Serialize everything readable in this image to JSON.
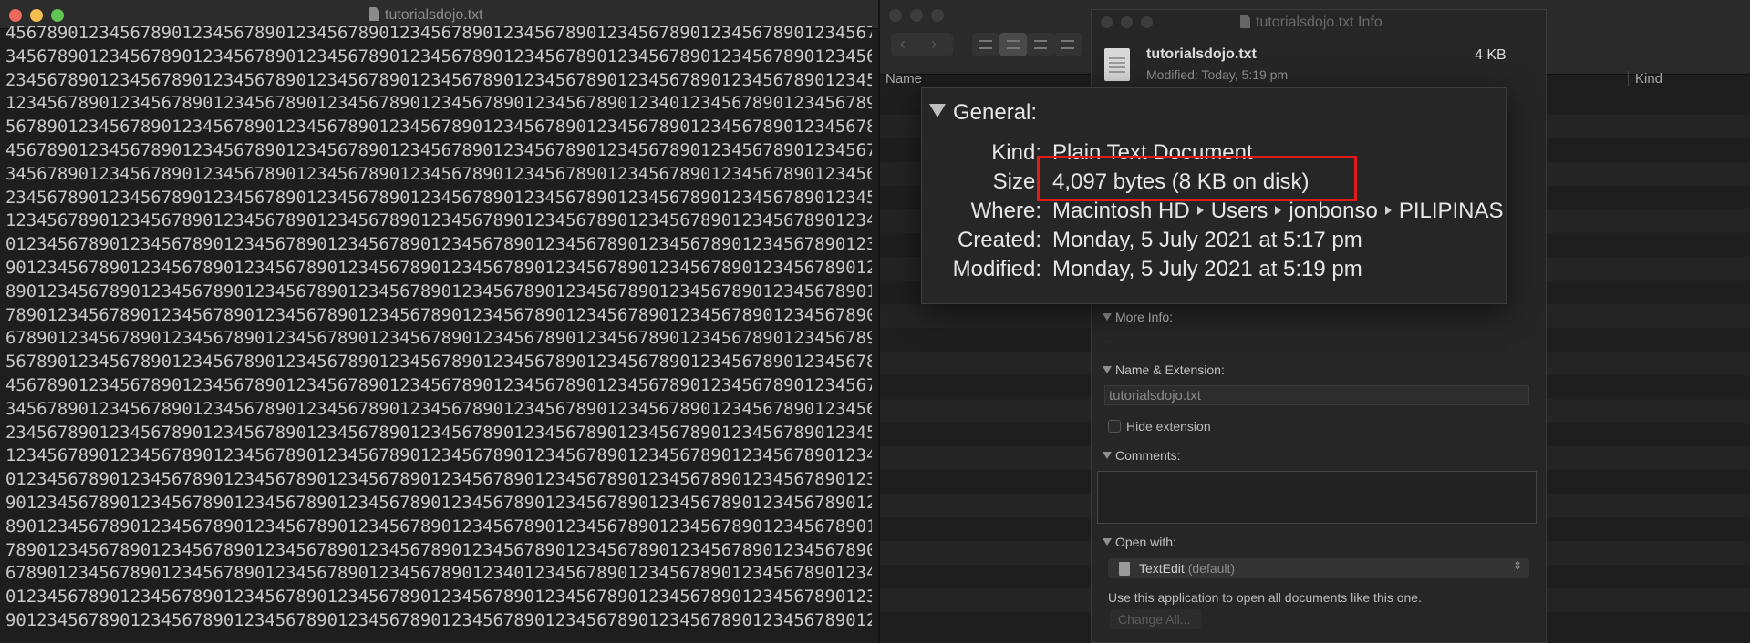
{
  "textedit": {
    "title": "tutorialsdojo.txt",
    "content": "45678901234567890123456789012345678901234567890123456789012345678901234567890123456789012\n34567890123456789012345678901234567890123456789012345678901234567890123456789012345678901\n23456789012345678901234567890123456789012345678901234567890123456789012345678901234567890\n12345678901234567890123456789012345678901234567890123456789012340123456789012345678901234\n56789012345678901234567890123456789012345678901234567890123456789012345678901234567890123\n45678901234567890123456789012345678901234567890123456789012345678901234567890123456789012\n34567890123456789012345678901234567890123456789012345678901234567890123456789012345678901\n23456789012345678901234567890123456789012345678901234567890123456789012345678901234567890\n12345678901234567890123456789012345678901234567890123456789012345678901234567890123456789\n01234567890123456789012345678901234567890123456789012345678901234567890123456789012345678\n90123456789012345678901234567890123456789012345678901234567890123456789012345678901234567\n89012345678901234567890123456789012345678901234567890123456789012345678901234567890123456\n78901234567890123456789012345678901234567890123456789012345678901234567890123456789012345\n67890123456789012345678901234567890123456789012345678901234567890123456789012345678901234\n56789012345678901234567890123456789012345678901234567890123456789012345678901234567890123\n45678901234567890123456789012345678901234567890123456789012345678901234567890123456789012\n34567890123456789012345678901234567890123456789012345678901234567890123456789012345678901\n23456789012345678901234567890123456789012345678901234567890123456789012345678901234567890\n12345678901234567890123456789012345678901234567890123456789012345678901234567890123456789\n01234567890123456789012345678901234567890123456789012345678901234567890123456789012345678\n90123456789012345678901234567890123456789012345678901234567890123456789012345678901234567\n89012345678901234567890123456789012345678901234567890123456789012345678901234567890123456\n78901234567890123456789012345678901234567890123456789012345678901234567890123456789012345\n67890123456789012345678901234567890123456789012340123456789012345678901234567890123456789\n01234567890123456789012345678901234567890123456789012345678901234567890123456789012345678\n90123456789012345678901234567890123456789012345678901234567890123456789012345678901234567"
  },
  "finder": {
    "columns": {
      "name": "Name",
      "date_fragment": "e",
      "kind": "Kind"
    }
  },
  "info_window": {
    "title": "tutorialsdojo.txt Info",
    "filename": "tutorialsdojo.txt",
    "filesize": "4 KB",
    "modified": "Modified: Today, 5:19 pm",
    "sections": {
      "more_info": "More Info:",
      "more_info_value": "--",
      "name_extension": "Name & Extension:",
      "name_value": "tutorialsdojo.txt",
      "hide_extension": "Hide extension",
      "comments": "Comments:",
      "open_with": "Open with:",
      "app_name": "TextEdit",
      "app_default": "(default)",
      "use_app_text": "Use this application to open all documents like this one.",
      "change_all": "Change All..."
    }
  },
  "general_panel": {
    "header": "General:",
    "kind_label": "Kind:",
    "kind_value": "Plain Text Document",
    "size_label": "Size:",
    "size_value": "4,097 bytes (8 KB on disk)",
    "where_label": "Where:",
    "where_path": [
      "Macintosh HD",
      "Users",
      "jonbonso",
      "PILIPINAS"
    ],
    "created_label": "Created:",
    "created_value": "Monday, 5 July 2021 at 5:17 pm",
    "modified_label": "Modified:",
    "modified_value": "Monday, 5 July 2021 at 5:19 pm"
  },
  "colors": {
    "highlight": "#e11b1b",
    "close": "#ed6a5e",
    "minimize": "#f5bf4f",
    "zoom": "#61c554"
  }
}
